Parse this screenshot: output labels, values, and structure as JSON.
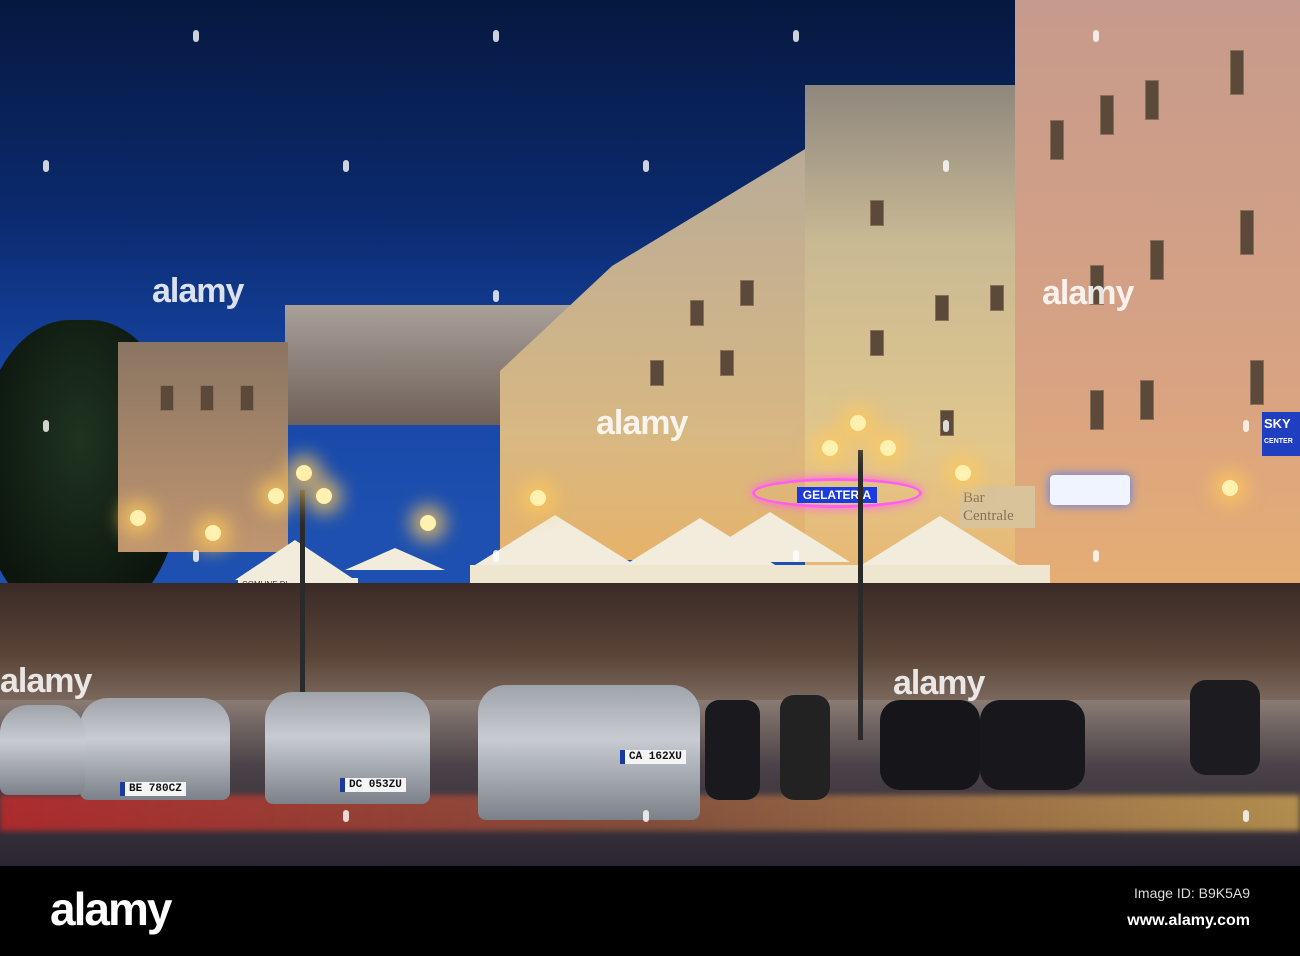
{
  "photo": {
    "signs": {
      "gelateria": "GELATERIA",
      "bar": "Bar Centrale",
      "sky": "SKY",
      "sky_sub": "CENTER",
      "comune": "COMUNE DI"
    },
    "plates": [
      "BE 780CZ",
      "DC 053ZU",
      "CA 162XU"
    ],
    "watermark": "alamy"
  },
  "footer": {
    "logo": "alamy",
    "image_id": "Image ID: B9K5A9",
    "url": "www.alamy.com"
  }
}
